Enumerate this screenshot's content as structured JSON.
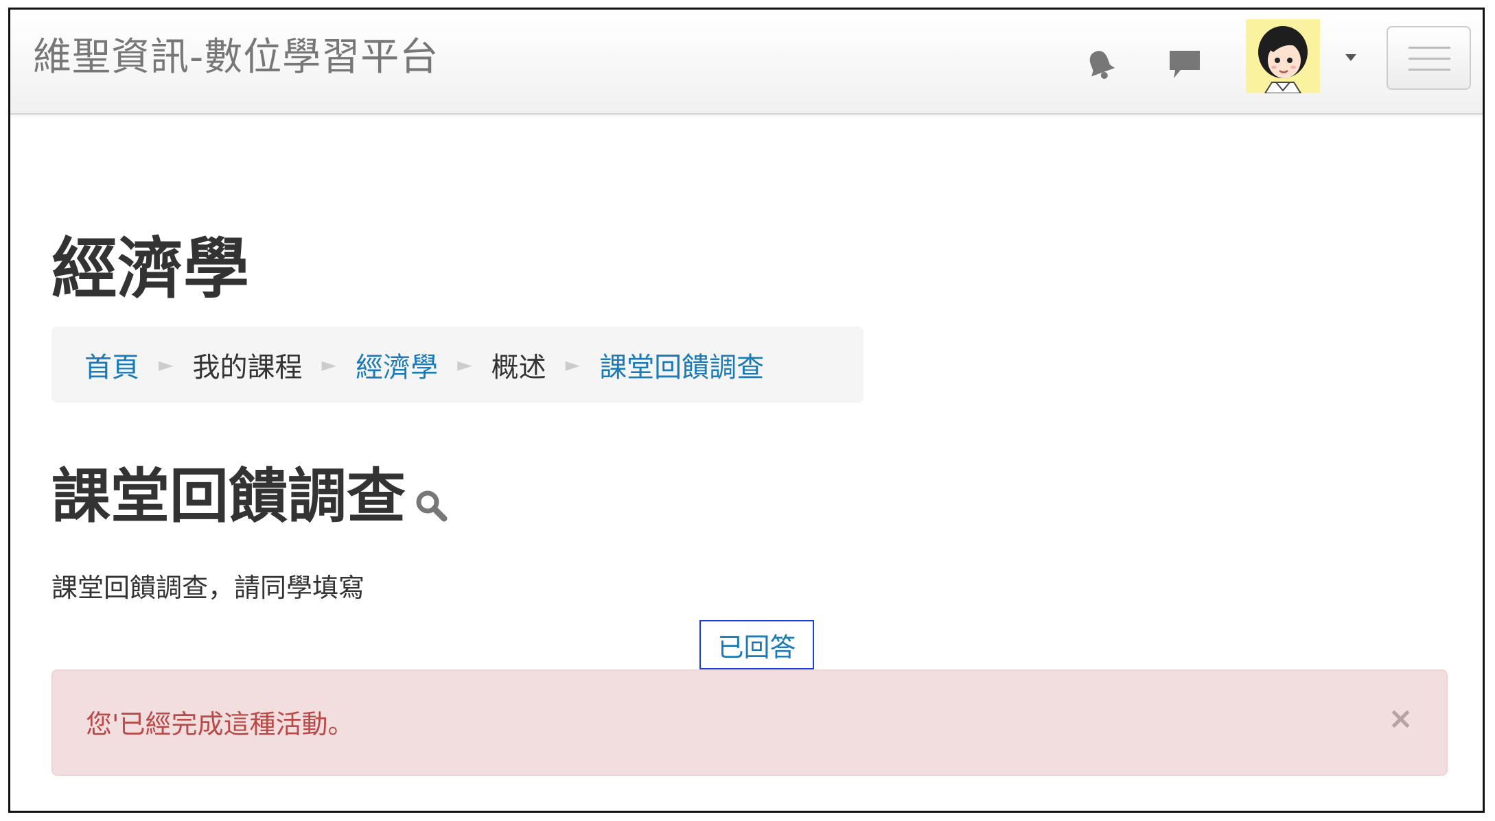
{
  "header": {
    "site_name": "維聖資訊-數位學習平台"
  },
  "page": {
    "course_title": "經濟學"
  },
  "breadcrumb": {
    "items": [
      {
        "label": "首頁"
      },
      {
        "label": "我的課程"
      },
      {
        "label": "經濟學"
      },
      {
        "label": "概述"
      },
      {
        "label": "課堂回饋調查"
      }
    ],
    "separator": "►"
  },
  "activity": {
    "title": "課堂回饋調查",
    "description": "課堂回饋調查，請同學填寫",
    "status_label": "已回答"
  },
  "alert": {
    "message": "您'已經完成這種活動。",
    "close_symbol": "×"
  },
  "icons": {
    "notifications": "bell-icon",
    "messages": "chat-bubble-icon",
    "user": "avatar",
    "menu": "hamburger-menu-icon",
    "search": "search-icon"
  },
  "colors": {
    "link": "#1b7bb8",
    "alert_background": "#f2dede",
    "alert_text": "#b94a48",
    "highlight_border": "#1a3fdc"
  }
}
